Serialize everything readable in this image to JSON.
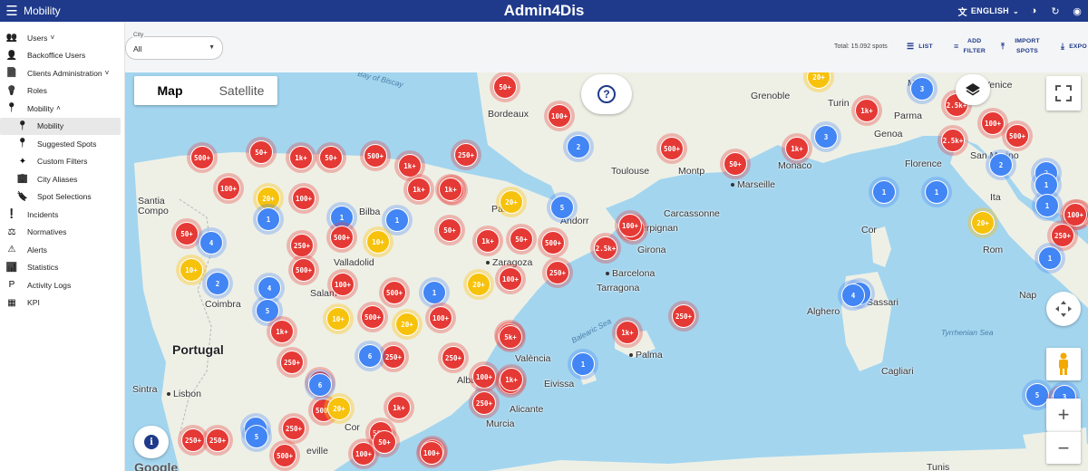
{
  "header": {
    "section_title": "Mobility",
    "app_title": "Admin4Dis",
    "language": "ENGLISH",
    "icons": [
      "menu-icon",
      "translate-icon",
      "chevron-down-icon",
      "theme-icon",
      "refresh-icon",
      "account-icon"
    ]
  },
  "sidebar": {
    "items": [
      {
        "label": "Users",
        "icon": "users-icon",
        "expandable": "down"
      },
      {
        "label": "Backoffice Users",
        "icon": "backoffice-users-icon"
      },
      {
        "label": "Clients Administration",
        "icon": "clients-icon",
        "expandable": "down"
      },
      {
        "label": "Roles",
        "icon": "roles-icon"
      },
      {
        "label": "Mobility",
        "icon": "location-pin-icon",
        "expandable": "up"
      },
      {
        "label": "Mobility",
        "icon": "location-pin-icon",
        "sub": true,
        "active": true
      },
      {
        "label": "Suggested Spots",
        "icon": "location-pin-icon",
        "sub": true
      },
      {
        "label": "Custom Filters",
        "icon": "sparkle-icon",
        "sub": true
      },
      {
        "label": "City Aliases",
        "icon": "city-icon",
        "sub": true
      },
      {
        "label": "Spot Selections",
        "icon": "bookmark-icon",
        "sub": true
      },
      {
        "label": "Incidents",
        "icon": "incident-icon"
      },
      {
        "label": "Normatives",
        "icon": "normatives-icon"
      },
      {
        "label": "Alerts",
        "icon": "alert-icon"
      },
      {
        "label": "Statistics",
        "icon": "statistics-icon"
      },
      {
        "label": "Activity Logs",
        "icon": "activity-logs-icon"
      },
      {
        "label": "KPI",
        "icon": "kpi-icon"
      }
    ]
  },
  "filters": {
    "city_label": "City",
    "city_value": "All",
    "total": "Total: 15.092 spots",
    "actions": {
      "list": "LIST",
      "add_filter_1": "ADD",
      "add_filter_2": "FILTER",
      "import_1": "IMPORT",
      "import_2": "SPOTS",
      "export": "EXPO"
    }
  },
  "map": {
    "map_type_map": "Map",
    "map_type_satellite": "Satellite",
    "google": "Google",
    "labels": [
      {
        "text": "Bay of Biscay",
        "kind": "sea"
      },
      {
        "text": "Bordeaux",
        "kind": "city"
      },
      {
        "text": "Grenoble",
        "kind": "city"
      },
      {
        "text": "Milan",
        "kind": "city"
      },
      {
        "text": "Venice",
        "kind": "dot"
      },
      {
        "text": "Turin",
        "kind": "city"
      },
      {
        "text": "Parma",
        "kind": "city"
      },
      {
        "text": "Genoa",
        "kind": "city"
      },
      {
        "text": "Toulouse",
        "kind": "city"
      },
      {
        "text": "Montp",
        "kind": "city"
      },
      {
        "text": "Monaco",
        "kind": "city"
      },
      {
        "text": "Marseille",
        "kind": "dot"
      },
      {
        "text": "Carcassonne",
        "kind": "city"
      },
      {
        "text": "Perpignan",
        "kind": "city"
      },
      {
        "text": "Florence",
        "kind": "city"
      },
      {
        "text": "San Marino",
        "kind": "city"
      },
      {
        "text": "Santia",
        "kind": "city"
      },
      {
        "text": "Compo",
        "kind": "city"
      },
      {
        "text": "Bilba",
        "kind": "city"
      },
      {
        "text": "Pamp",
        "kind": "city"
      },
      {
        "text": "Andorr",
        "kind": "city"
      },
      {
        "text": "Girona",
        "kind": "city"
      },
      {
        "text": "Valladolid",
        "kind": "city"
      },
      {
        "text": "Zaragoza",
        "kind": "dot"
      },
      {
        "text": "Barcelona",
        "kind": "dot"
      },
      {
        "text": "Tarragona",
        "kind": "city"
      },
      {
        "text": "Salam",
        "kind": "city"
      },
      {
        "text": "Coimbra",
        "kind": "city"
      },
      {
        "text": "Portugal",
        "kind": "big"
      },
      {
        "text": "Balearic Sea",
        "kind": "sea"
      },
      {
        "text": "València",
        "kind": "city"
      },
      {
        "text": "Palma",
        "kind": "dot"
      },
      {
        "text": "Eivissa",
        "kind": "city"
      },
      {
        "text": "Sintra",
        "kind": "city"
      },
      {
        "text": "Lisbon",
        "kind": "dot"
      },
      {
        "text": "Albac",
        "kind": "city"
      },
      {
        "text": "Alicante",
        "kind": "city"
      },
      {
        "text": "Murcia",
        "kind": "city"
      },
      {
        "text": "Cor",
        "kind": "city"
      },
      {
        "text": "eville",
        "kind": "city"
      },
      {
        "text": "Alghero",
        "kind": "city"
      },
      {
        "text": "Sassari",
        "kind": "city"
      },
      {
        "text": "Tyrrhenian Sea",
        "kind": "sea"
      },
      {
        "text": "Cagliari",
        "kind": "city"
      },
      {
        "text": "Rom",
        "kind": "city"
      },
      {
        "text": "Nap",
        "kind": "city"
      },
      {
        "text": "Ita",
        "kind": "city"
      },
      {
        "text": "Cor",
        "kind": "city"
      },
      {
        "text": "Tunis",
        "kind": "city"
      }
    ],
    "clusters": [
      {
        "label": "50+",
        "color": "red"
      },
      {
        "label": "20+",
        "color": "yellow"
      },
      {
        "label": "3",
        "color": "blue"
      },
      {
        "label": "100+",
        "color": "red"
      },
      {
        "label": "1k+",
        "color": "red"
      },
      {
        "label": "2.5k+",
        "color": "red"
      },
      {
        "label": "100+",
        "color": "red"
      },
      {
        "label": "2",
        "color": "blue"
      },
      {
        "label": "3",
        "color": "blue"
      },
      {
        "label": "500+",
        "color": "red"
      },
      {
        "label": "2.5k+",
        "color": "red"
      },
      {
        "label": "1k+",
        "color": "red"
      },
      {
        "label": "2",
        "color": "blue"
      },
      {
        "label": "2",
        "color": "blue"
      },
      {
        "label": "500+",
        "color": "red"
      },
      {
        "label": "50+",
        "color": "red"
      },
      {
        "label": "500+",
        "color": "red"
      },
      {
        "label": "50+",
        "color": "red"
      },
      {
        "label": "1k+",
        "color": "red"
      },
      {
        "label": "50+",
        "color": "red"
      },
      {
        "label": "500+",
        "color": "red"
      },
      {
        "label": "1k+",
        "color": "red"
      },
      {
        "label": "1k+",
        "color": "red"
      },
      {
        "label": "250+",
        "color": "red"
      },
      {
        "label": "1",
        "color": "blue"
      },
      {
        "label": "1",
        "color": "blue"
      },
      {
        "label": "1",
        "color": "blue"
      },
      {
        "label": "1",
        "color": "blue"
      },
      {
        "label": "1k+",
        "color": "red"
      },
      {
        "label": "1k+",
        "color": "red"
      },
      {
        "label": "100+",
        "color": "red"
      },
      {
        "label": "20+",
        "color": "yellow"
      },
      {
        "label": "100+",
        "color": "red"
      },
      {
        "label": "1k+",
        "color": "red"
      },
      {
        "label": "20+",
        "color": "yellow"
      },
      {
        "label": "5",
        "color": "blue"
      },
      {
        "label": "100+",
        "color": "red"
      },
      {
        "label": "20+",
        "color": "yellow"
      },
      {
        "label": "1",
        "color": "blue"
      },
      {
        "label": "250+",
        "color": "red"
      },
      {
        "label": "1",
        "color": "blue"
      },
      {
        "label": "1",
        "color": "blue"
      },
      {
        "label": "50+",
        "color": "red"
      },
      {
        "label": "4",
        "color": "blue"
      },
      {
        "label": "500+",
        "color": "red"
      },
      {
        "label": "10+",
        "color": "yellow"
      },
      {
        "label": "50+",
        "color": "red"
      },
      {
        "label": "1k+",
        "color": "red"
      },
      {
        "label": "50+",
        "color": "red"
      },
      {
        "label": "500+",
        "color": "red"
      },
      {
        "label": "2.5k+",
        "color": "red"
      },
      {
        "label": "1k+",
        "color": "red"
      },
      {
        "label": "100+",
        "color": "red"
      },
      {
        "label": "250+",
        "color": "red"
      },
      {
        "label": "500+",
        "color": "red"
      },
      {
        "label": "250+",
        "color": "red"
      },
      {
        "label": "10+",
        "color": "yellow"
      },
      {
        "label": "2",
        "color": "blue"
      },
      {
        "label": "4",
        "color": "blue"
      },
      {
        "label": "100+",
        "color": "red"
      },
      {
        "label": "500+",
        "color": "red"
      },
      {
        "label": "1",
        "color": "blue"
      },
      {
        "label": "20+",
        "color": "yellow"
      },
      {
        "label": "100+",
        "color": "red"
      },
      {
        "label": "5",
        "color": "blue"
      },
      {
        "label": "10+",
        "color": "yellow"
      },
      {
        "label": "500+",
        "color": "red"
      },
      {
        "label": "20+",
        "color": "yellow"
      },
      {
        "label": "100+",
        "color": "red"
      },
      {
        "label": "250+",
        "color": "red"
      },
      {
        "label": "1k+",
        "color": "red"
      },
      {
        "label": "1",
        "color": "blue"
      },
      {
        "label": "4",
        "color": "blue"
      },
      {
        "label": "1",
        "color": "blue"
      },
      {
        "label": "500+",
        "color": "red"
      },
      {
        "label": "5k+",
        "color": "red"
      },
      {
        "label": "1k+",
        "color": "red"
      },
      {
        "label": "250+",
        "color": "red"
      },
      {
        "label": "250+",
        "color": "red"
      },
      {
        "label": "6",
        "color": "blue"
      },
      {
        "label": "1",
        "color": "blue"
      },
      {
        "label": "100+",
        "color": "red"
      },
      {
        "label": "500+",
        "color": "red"
      },
      {
        "label": "100+",
        "color": "red"
      },
      {
        "label": "250+",
        "color": "red"
      },
      {
        "label": "50+",
        "color": "red"
      },
      {
        "label": "250+",
        "color": "red"
      },
      {
        "label": "1k+",
        "color": "red"
      },
      {
        "label": "6",
        "color": "blue"
      },
      {
        "label": "5",
        "color": "blue"
      },
      {
        "label": "250+",
        "color": "red"
      },
      {
        "label": "20+",
        "color": "yellow"
      },
      {
        "label": "1k+",
        "color": "red"
      },
      {
        "label": "250+",
        "color": "red"
      },
      {
        "label": "3",
        "color": "blue"
      },
      {
        "label": "3",
        "color": "blue"
      },
      {
        "label": "250+",
        "color": "red"
      },
      {
        "label": "5",
        "color": "blue"
      },
      {
        "label": "250+",
        "color": "red"
      },
      {
        "label": "500+",
        "color": "red"
      },
      {
        "label": "500+",
        "color": "red"
      },
      {
        "label": "100+",
        "color": "red"
      },
      {
        "label": "2.5k+",
        "color": "red"
      },
      {
        "label": "50+",
        "color": "red"
      },
      {
        "label": "100+",
        "color": "red"
      }
    ]
  },
  "colors": {
    "primary": "#1f3a8a",
    "cluster_red": "#e53935",
    "cluster_yellow": "#f7c20c",
    "cluster_blue": "#4285f4",
    "sea": "#a3d5ef",
    "land": "#eef0e6"
  }
}
